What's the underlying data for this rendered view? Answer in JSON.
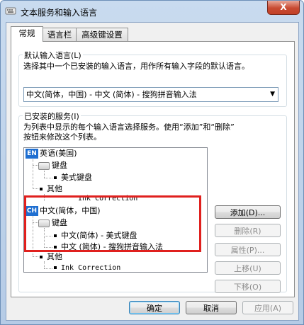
{
  "window": {
    "title": "文本服务和输入语言",
    "close_symbol": "X"
  },
  "tabs": [
    {
      "label": "常规",
      "active": true
    },
    {
      "label": "语言栏",
      "active": false
    },
    {
      "label": "高级键设置",
      "active": false
    }
  ],
  "default_input": {
    "group_title": "默认输入语言(L)",
    "description": "选择其中一个已安装的输入语言，用作所有输入字段的默认语言。",
    "selected_value": "中文(简体，中国) - 中文 (简体) - 搜狗拼音输入法"
  },
  "installed_services": {
    "group_title": "已安装的服务(I)",
    "description_line1": "为列表中显示的每个输入语言选择服务。使用“添加”和“删除”",
    "description_line2": "按钮来修改这个列表。",
    "tree": {
      "lang1": {
        "badge": "EN",
        "name": "英语(美国)"
      },
      "lang1_keyboard": "键盘",
      "lang1_kb_item": "美式键盘",
      "lang1_other": "其他",
      "lang1_other_item": "Ink Correction",
      "lang2": {
        "badge": "CH",
        "name": "中文(简体，中国)"
      },
      "lang2_keyboard": "键盘",
      "lang2_kb_item1": "中文(简体) - 美式键盘",
      "lang2_kb_item2": "中文 (简体) - 搜狗拼音输入法",
      "lang2_other": "其他",
      "lang2_other_item": "Ink Correction"
    },
    "buttons": {
      "add": "添加(D)...",
      "remove": "删除(R)",
      "properties": "属性(P)...",
      "move_up": "上移(U)",
      "move_down": "下移(O)"
    }
  },
  "footer": {
    "ok": "确定",
    "cancel": "取消",
    "apply": "应用(A)"
  },
  "colors": {
    "highlight_border": "#e0201e",
    "lang_badge": "#1f6fd1"
  }
}
